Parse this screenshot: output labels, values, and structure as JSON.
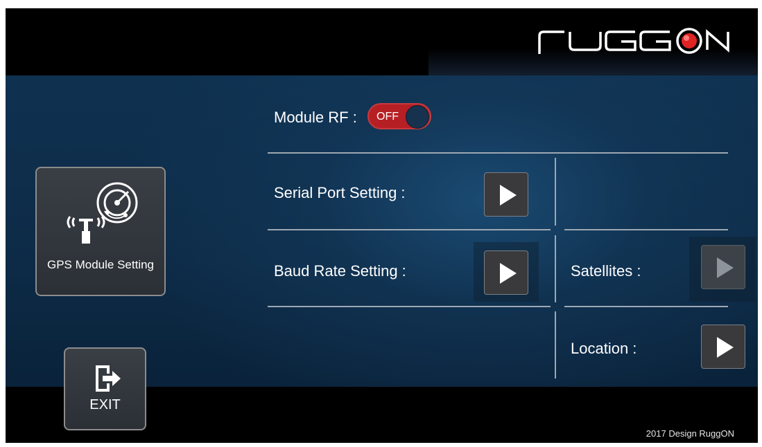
{
  "brand": {
    "logo_text": "RuggON"
  },
  "sidebar": {
    "gps_button": {
      "label": "GPS Module Setting",
      "icon": "gps-radar-antenna-icon"
    },
    "exit_button": {
      "label": "EXIT",
      "icon": "exit-door-icon"
    }
  },
  "module_rf": {
    "label": "Module RF :",
    "toggle_state": "OFF",
    "toggle_color": "#b61f24"
  },
  "settings": {
    "serial_port": {
      "label": "Serial Port Setting :"
    },
    "baud_rate": {
      "label": "Baud Rate Setting :"
    },
    "satellites": {
      "label": "Satellites :",
      "enabled": false
    },
    "location": {
      "label": "Location :"
    }
  },
  "footer": {
    "copyright": "2017 Design RuggON"
  }
}
